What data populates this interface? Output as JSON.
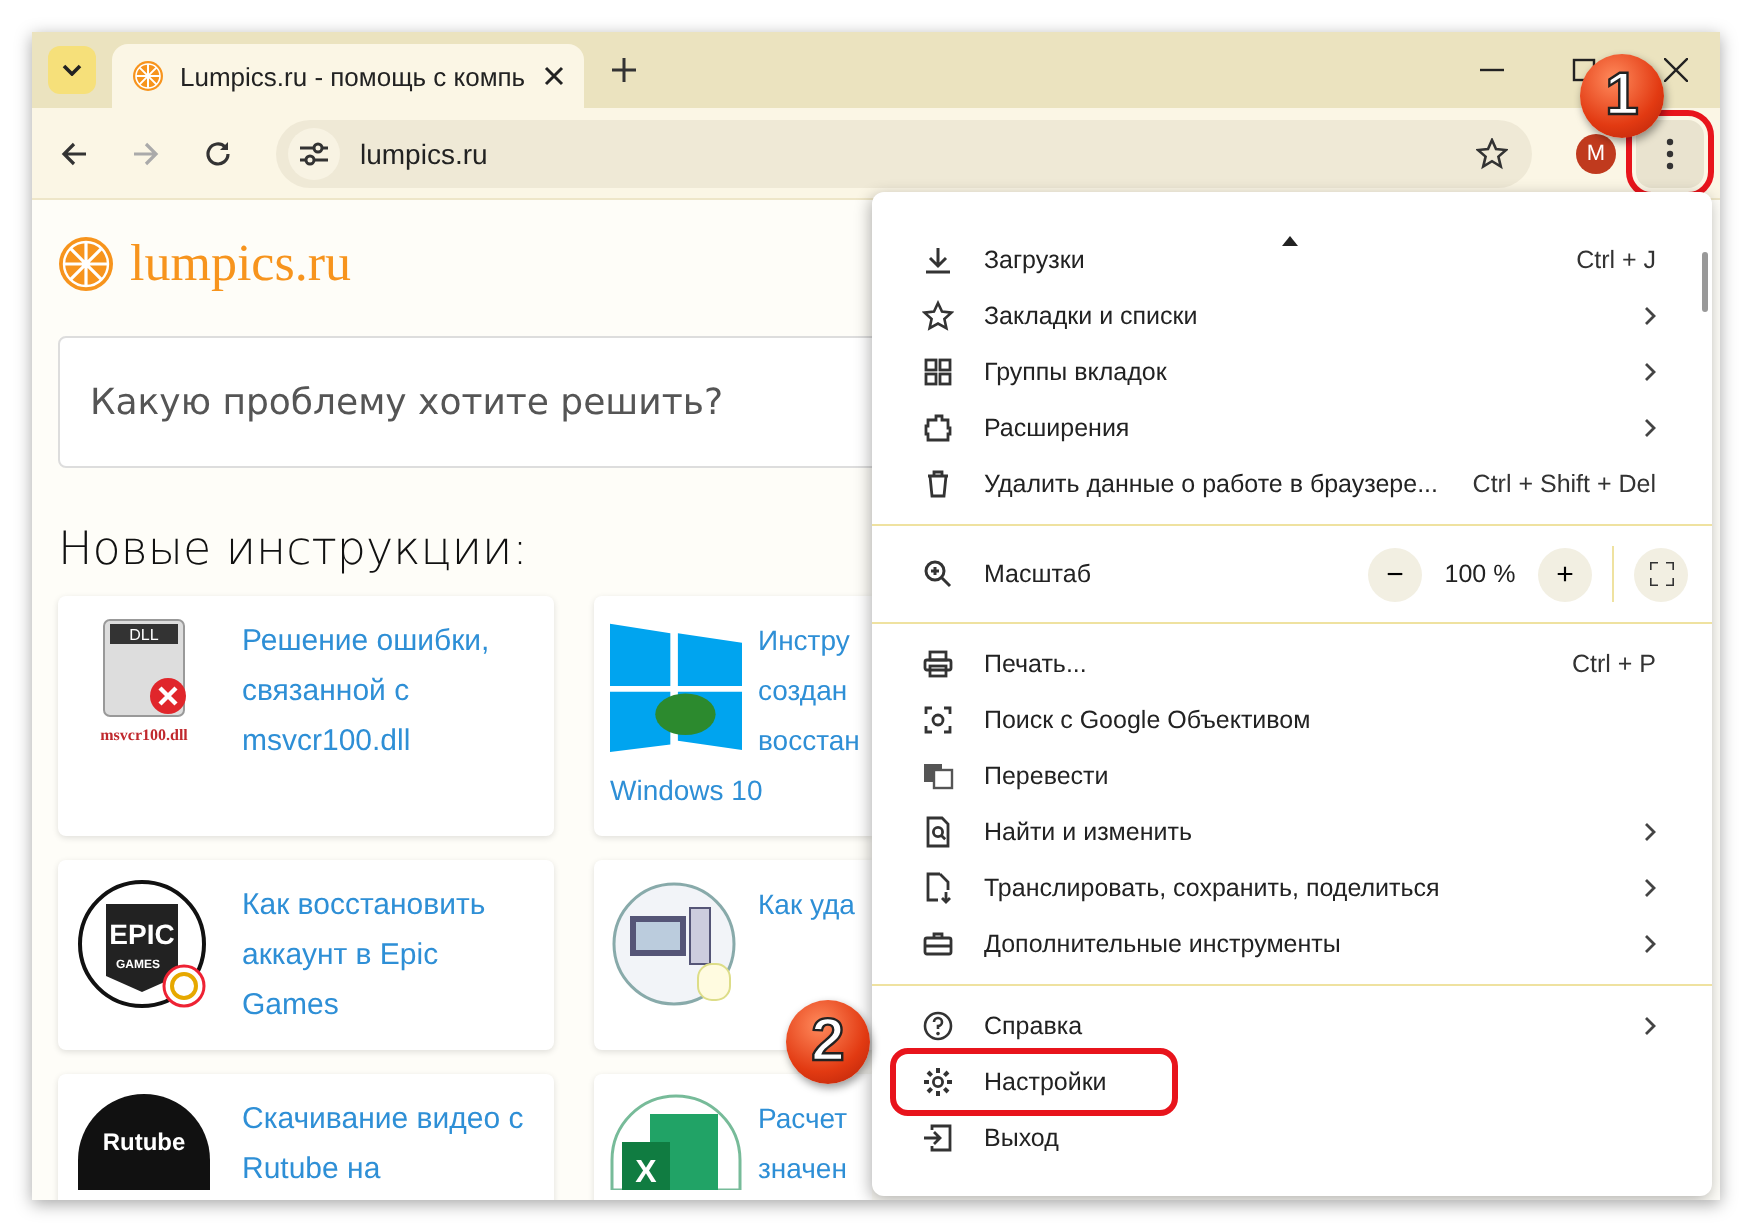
{
  "tab_strip": {
    "tab": {
      "title": "Lumpics.ru - помощь с компь",
      "selected": true
    }
  },
  "toolbar": {
    "address": "lumpics.ru",
    "profile_initial": "M",
    "forward_disabled": true
  },
  "page": {
    "logo": "lumpics.ru",
    "search": {
      "placeholder": "Какую проблему хотите решить?"
    },
    "heading": "Новые инструкции:",
    "cards": [
      {
        "lines": [
          "Решение ошибки,",
          "связанной с",
          "msvcr100.dll"
        ],
        "thumb_caption": "msvcr100.dll",
        "thumb_label": "DLL"
      },
      {
        "lines": [
          "Инстру",
          "создан",
          "восстан",
          "Windows 10"
        ]
      },
      {
        "lines": [
          "Как восстановить",
          "аккаунт в Epic",
          "Games"
        ],
        "thumb_label": "EPIC",
        "thumb_caption": "GAMES"
      },
      {
        "lines": [
          "Как уда"
        ]
      },
      {
        "lines": [
          "Скачивание видео с",
          "Rutube на"
        ],
        "thumb_label": "Rutube"
      },
      {
        "lines": [
          "Расчет",
          "значен"
        ],
        "thumb_label": "X"
      }
    ]
  },
  "menu": {
    "items": [
      {
        "kind": "item",
        "label": "Загрузки",
        "shortcut": "Ctrl + J",
        "submenu": false,
        "highlighted": false
      },
      {
        "kind": "item",
        "label": "Закладки и списки",
        "submenu": true,
        "highlighted": false
      },
      {
        "kind": "item",
        "label": "Группы вкладок",
        "submenu": true,
        "highlighted": false
      },
      {
        "kind": "item",
        "label": "Расширения",
        "submenu": true,
        "highlighted": false
      },
      {
        "kind": "item",
        "label": "Удалить данные о работе в браузере...",
        "shortcut": "Ctrl + Shift + Del",
        "submenu": false,
        "highlighted": false
      },
      {
        "kind": "separator"
      },
      {
        "kind": "zoom",
        "label": "Масштаб",
        "value": "100 %",
        "minus": "−",
        "plus": "+"
      },
      {
        "kind": "separator"
      },
      {
        "kind": "item",
        "label": "Печать...",
        "shortcut": "Ctrl + P",
        "submenu": false,
        "highlighted": false
      },
      {
        "kind": "item",
        "label": "Поиск с Google Объективом",
        "submenu": false,
        "highlighted": false
      },
      {
        "kind": "item",
        "label": "Перевести",
        "submenu": false,
        "highlighted": false
      },
      {
        "kind": "item",
        "label": "Найти и изменить",
        "submenu": true,
        "highlighted": false
      },
      {
        "kind": "item",
        "label": "Транслировать, сохранить, поделиться",
        "submenu": true,
        "highlighted": false
      },
      {
        "kind": "item",
        "label": "Дополнительные инструменты",
        "submenu": true,
        "highlighted": false
      },
      {
        "kind": "separator"
      },
      {
        "kind": "item",
        "label": "Справка",
        "submenu": true,
        "highlighted": false
      },
      {
        "kind": "item",
        "label": "Настройки",
        "submenu": false,
        "highlighted": true
      },
      {
        "kind": "item",
        "label": "Выход",
        "submenu": false,
        "highlighted": false
      }
    ]
  },
  "annotations": [
    {
      "number": "1"
    },
    {
      "number": "2"
    }
  ],
  "menu_button_highlighted": true
}
